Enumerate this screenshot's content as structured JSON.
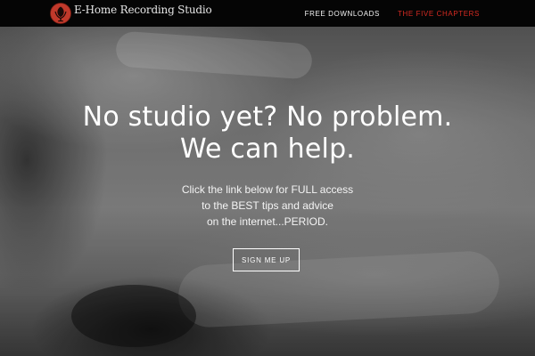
{
  "header": {
    "brand_name": "E-Home Recording Studio",
    "logo_icon": "red-circle-microphone-logo-icon",
    "nav": [
      {
        "label": "FREE DOWNLOADS",
        "active": false
      },
      {
        "label": "THE FIVE CHAPTERS",
        "active": true
      }
    ]
  },
  "hero": {
    "headline_line1": "No studio yet? No problem.",
    "headline_line2": "We can help.",
    "subtext_line1": "Click the link below for FULL access",
    "subtext_line2": "to the BEST tips and advice",
    "subtext_line3": "on the internet...PERIOD.",
    "cta_label": "SIGN ME UP"
  },
  "colors": {
    "navbar_bg": "#050505",
    "active_nav": "#d82b22",
    "logo_red": "#c0392b",
    "text": "#ffffff"
  }
}
